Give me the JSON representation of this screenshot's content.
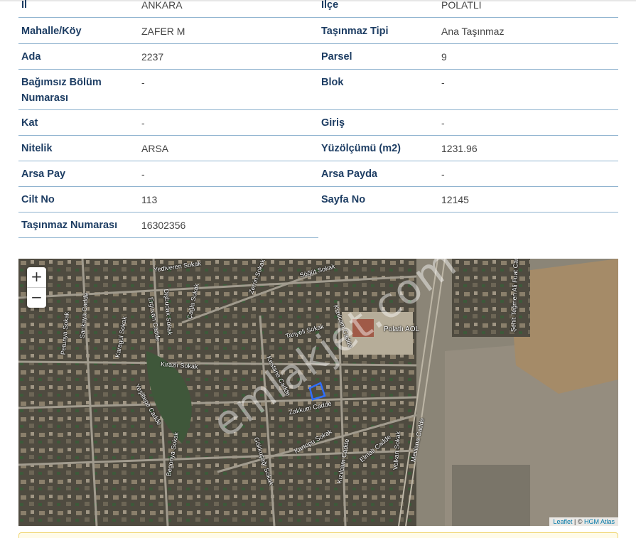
{
  "table": {
    "rows": [
      {
        "l1": "İl",
        "v1": "ANKARA",
        "l2": "İlçe",
        "v2": "POLATLI"
      },
      {
        "l1": "Mahalle/Köy",
        "v1": "ZAFER M",
        "l2": "Taşınmaz Tipi",
        "v2": "Ana Taşınmaz"
      },
      {
        "l1": "Ada",
        "v1": "2237",
        "l2": "Parsel",
        "v2": "9"
      },
      {
        "l1": "Bağımsız Bölüm Numarası",
        "v1": "-",
        "l2": "Blok",
        "v2": "-"
      },
      {
        "l1": "Kat",
        "v1": "-",
        "l2": "Giriş",
        "v2": "-"
      },
      {
        "l1": "Nitelik",
        "v1": "ARSA",
        "l2": "Yüzölçümü (m2)",
        "v2": "1231.96"
      },
      {
        "l1": "Arsa Pay",
        "v1": "-",
        "l2": "Arsa Payda",
        "v2": "-"
      },
      {
        "l1": "Cilt No",
        "v1": "113",
        "l2": "Sayfa No",
        "v2": "12145"
      },
      {
        "l1": "Taşınmaz Numarası",
        "v1": "16302356"
      }
    ]
  },
  "map": {
    "zoom_in": "+",
    "zoom_out": "−",
    "attribution_leaflet": "Leaflet",
    "attribution_sep": " | © ",
    "attribution_source": "HGM Atlas",
    "watermark": "emlakjet.com",
    "poi": "Polatlı AOL",
    "parcel_color": "#2f6fff",
    "streets": [
      "Yediveren Sokak",
      "Söğüt Sokak",
      "Zerrin Sokak",
      "Kızılcam Cadde",
      "Tanyeli Sokak",
      "Kirazlı Sokak",
      "Kestane Cadde",
      "Zakkum Cadde",
      "Kartopu Sokak",
      "Kızılcam Cadde",
      "Elmalı Cadde",
      "Begonya Sokak",
      "Gökkuşağı Sokak",
      "Yeşiltepe Cadde",
      "Mevlana Cadde",
      "Volkan Sokak",
      "Şehit Teğmen Ali Fuat Cadde",
      "Erguvan Cadde",
      "Dişbudak Sokak",
      "Sarıkaya Cadde",
      "Karagül Sokak",
      "Petunya Sokak",
      "Çağla Sokak"
    ]
  }
}
